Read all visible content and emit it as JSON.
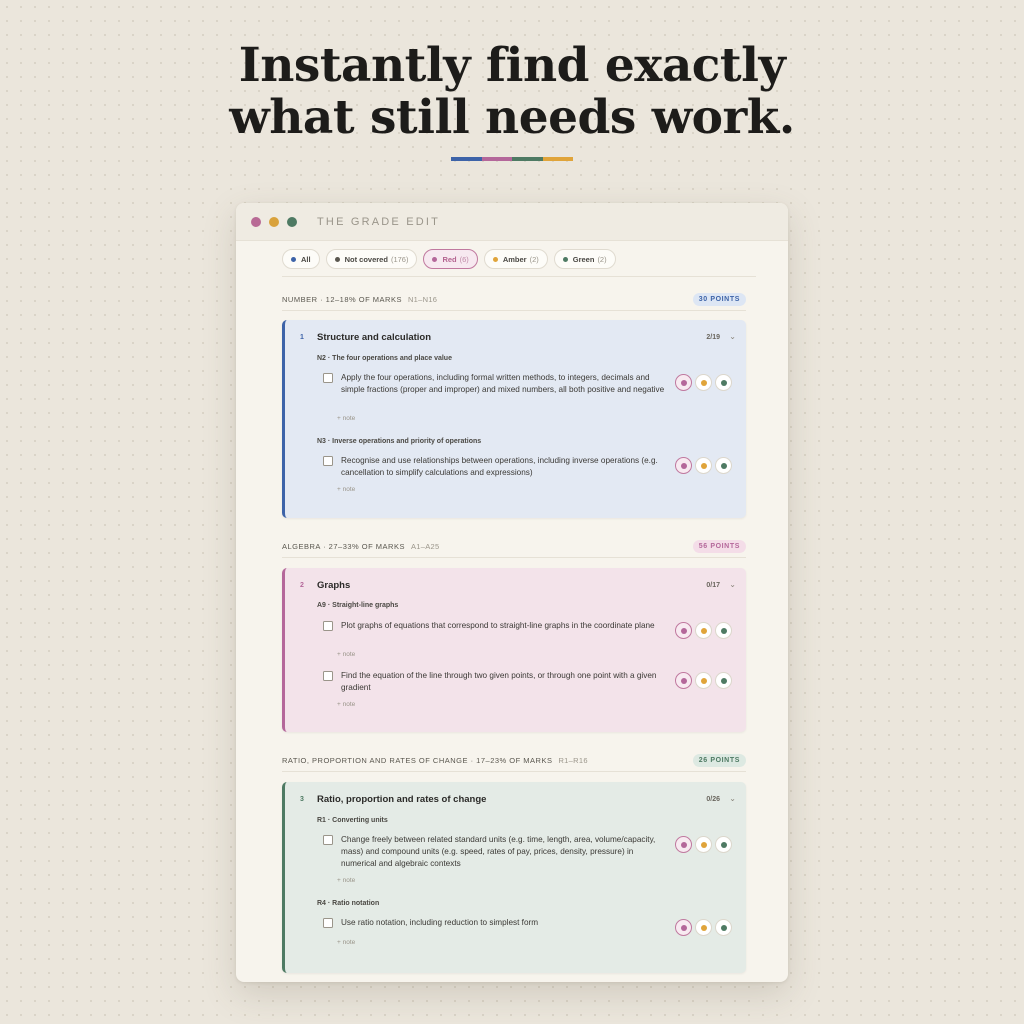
{
  "headline": {
    "line1": "Instantly find exactly",
    "line2": "what still needs work."
  },
  "colors": {
    "blue": "#3d63a8",
    "pink": "#b4679a",
    "green": "#4e7a63",
    "amber": "#e0a43a"
  },
  "window": {
    "title": "THE GRADE EDIT",
    "traffic_lights": [
      "#b86a95",
      "#d9a23c",
      "#4e7a63"
    ]
  },
  "filters": [
    {
      "label": "All",
      "count": "",
      "dot": "#3d63a8",
      "active": false
    },
    {
      "label": "Not covered",
      "count": "(176)",
      "dot": "#5a574f",
      "active": false
    },
    {
      "label": "Red",
      "count": "(6)",
      "dot": "#b4679a",
      "active": true
    },
    {
      "label": "Amber",
      "count": "(2)",
      "dot": "#e0a43a",
      "active": false
    },
    {
      "label": "Green",
      "count": "(2)",
      "dot": "#4e7a63",
      "active": false
    }
  ],
  "sections": [
    {
      "title": "NUMBER · 12–18% OF MARKS",
      "range": "N1–N16",
      "points": "30 POINTS",
      "card": {
        "num": "1",
        "title": "Structure and calculation",
        "count": "2/19",
        "groups": [
          {
            "label": "N2 · The four operations and place value",
            "items": [
              {
                "text": "Apply the four operations, including formal written methods, to integers, decimals and simple fractions (proper and improper) and mixed numbers, all both positive and negative",
                "note": "+ note"
              }
            ]
          },
          {
            "label": "N3 · Inverse operations and priority of operations",
            "items": [
              {
                "text": "Recognise and use relationships between operations, including inverse operations (e.g. cancellation to simplify calculations and expressions)",
                "note": "+ note"
              }
            ]
          }
        ]
      }
    },
    {
      "title": "ALGEBRA · 27–33% OF MARKS",
      "range": "A1–A25",
      "points": "56 POINTS",
      "card": {
        "num": "2",
        "title": "Graphs",
        "count": "0/17",
        "groups": [
          {
            "label": "A9 · Straight-line graphs",
            "items": [
              {
                "text": "Plot graphs of equations that correspond to straight-line graphs in the coordinate plane",
                "note": "+ note"
              },
              {
                "text": "Find the equation of the line through two given points, or through one point with a given gradient",
                "note": "+ note"
              }
            ]
          }
        ]
      }
    },
    {
      "title": "RATIO, PROPORTION AND RATES OF CHANGE · 17–23% OF MARKS",
      "range": "R1–R16",
      "points": "26 POINTS",
      "card": {
        "num": "3",
        "title": "Ratio, proportion and rates of change",
        "count": "0/26",
        "groups": [
          {
            "label": "R1 · Converting units",
            "items": [
              {
                "text": "Change freely between related standard units (e.g. time, length, area, volume/capacity, mass) and compound units (e.g. speed, rates of pay, prices, density, pressure) in numerical and algebraic contexts",
                "note": "+ note"
              }
            ]
          },
          {
            "label": "R4 · Ratio notation",
            "items": [
              {
                "text": "Use ratio notation, including reduction to simplest form",
                "note": "+ note"
              }
            ]
          }
        ]
      }
    }
  ]
}
